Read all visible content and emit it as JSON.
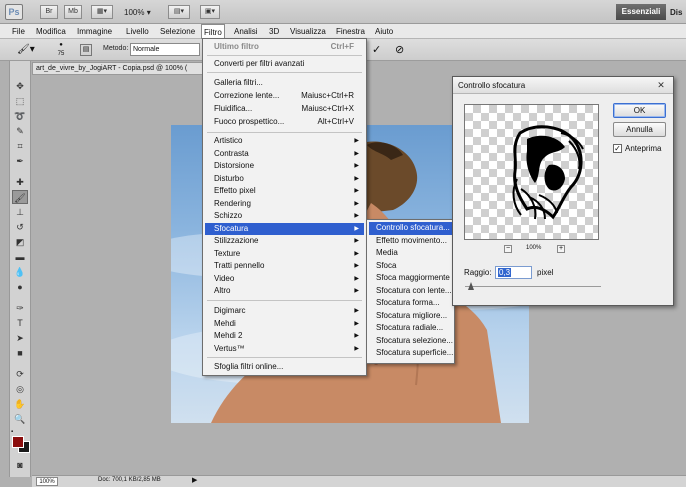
{
  "appbar": {
    "logo": "Ps",
    "btn_br": "Br",
    "btn_mb": "Mb",
    "zoom": "100%",
    "workspace": "Essenziali",
    "workspace_next": "Dis"
  },
  "menubar": [
    "File",
    "Modifica",
    "Immagine",
    "Livello",
    "Selezione",
    "Filtro",
    "Analisi",
    "3D",
    "Visualizza",
    "Finestra",
    "Aiuto"
  ],
  "options": {
    "brush_size": "75",
    "metodo_label": "Metodo:",
    "metodo_value": "Normale"
  },
  "document": {
    "tab_title": "art_de_vivre_by_JogiART - Copia.psd @ 100% (",
    "status_zoom": "100%",
    "status_doc": "Doc: 700,1 KB/2,85 MB"
  },
  "filter_menu": {
    "last_filter": {
      "label": "Ultimo filtro",
      "shortcut": "Ctrl+F"
    },
    "smart": "Converti per filtri avanzati",
    "gallery": "Galleria filtri...",
    "lens": {
      "label": "Correzione lente...",
      "shortcut": "Maiusc+Ctrl+R"
    },
    "liquify": {
      "label": "Fluidifica...",
      "shortcut": "Maiusc+Ctrl+X"
    },
    "vanishing": {
      "label": "Fuoco prospettico...",
      "shortcut": "Alt+Ctrl+V"
    },
    "groups": [
      "Artistico",
      "Contrasta",
      "Distorsione",
      "Disturbo",
      "Effetto pixel",
      "Rendering",
      "Schizzo",
      "Sfocatura",
      "Stilizzazione",
      "Texture",
      "Tratti pennello",
      "Video",
      "Altro"
    ],
    "plugins": [
      "Digimarc",
      "Mehdi",
      "Mehdi 2",
      "Vertus™"
    ],
    "browse": "Sfoglia filtri online..."
  },
  "blur_submenu": [
    "Controllo sfocatura...",
    "Effetto movimento...",
    "Media",
    "Sfoca",
    "Sfoca maggiormente",
    "Sfocatura con lente...",
    "Sfocatura forma...",
    "Sfocatura migliore...",
    "Sfocatura radiale...",
    "Sfocatura selezione...",
    "Sfocatura superficie..."
  ],
  "dialog": {
    "title": "Controllo sfocatura",
    "ok": "OK",
    "cancel": "Annulla",
    "preview_label": "Anteprima",
    "preview_checked": true,
    "preview_zoom": "100%",
    "radius_label": "Raggio:",
    "radius_value": "0,3",
    "radius_unit": "pixel",
    "radius_slider_fraction": 0.02
  },
  "colors": {
    "highlight": "#2f5fcf",
    "foreground": "#8b0d0d",
    "background": "#1a1a1a"
  }
}
